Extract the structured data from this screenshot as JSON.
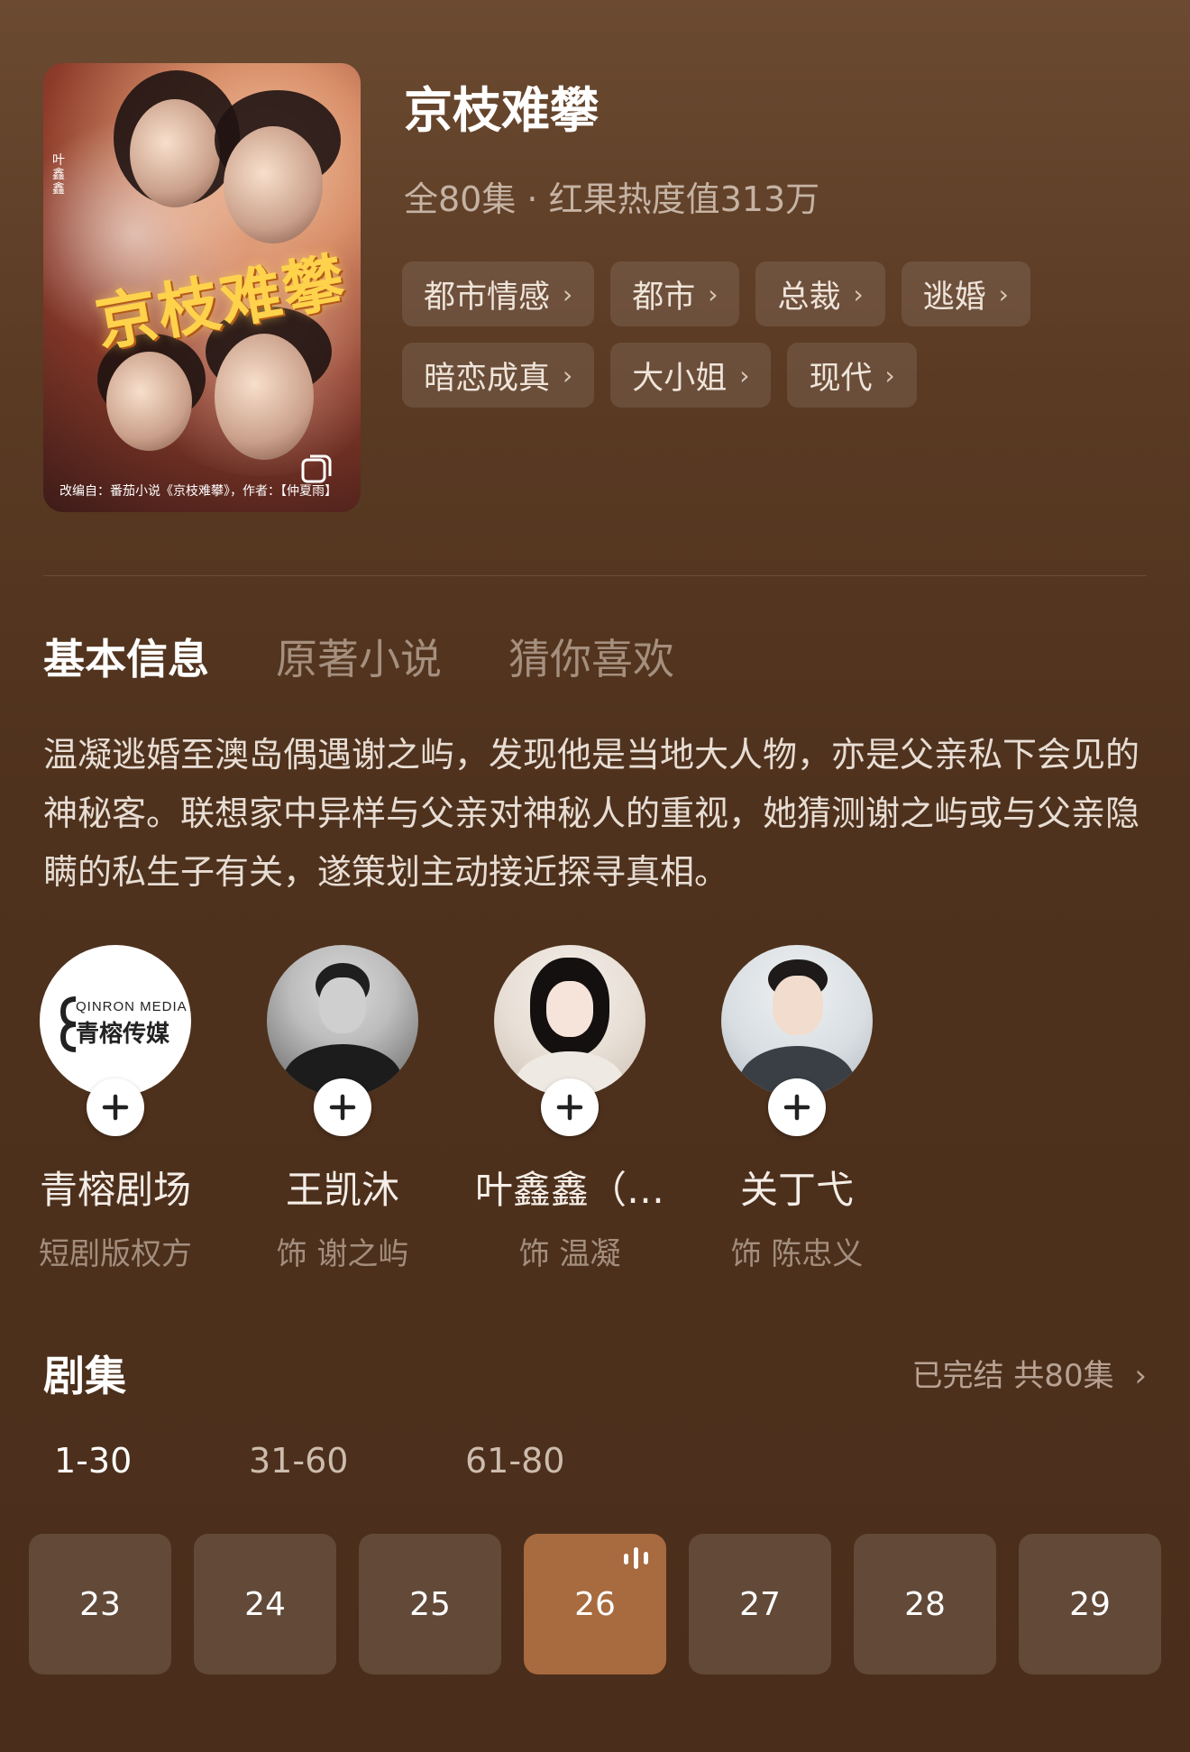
{
  "drama": {
    "title": "京枝难攀",
    "meta": "全80集 · 红果热度值313万",
    "tags": [
      "都市情感",
      "都市",
      "总裁",
      "逃婚",
      "暗恋成真",
      "大小姐",
      "现代"
    ]
  },
  "poster": {
    "title_art": "京枝难攀",
    "side_text": "叶鑫鑫",
    "caption": "改编自：番茄小说《京枝难攀》，作者：【仲夏雨】"
  },
  "tabs": [
    "基本信息",
    "原著小说",
    "猜你喜欢"
  ],
  "description": "温凝逃婚至澳岛偶遇谢之屿，发现他是当地大人物，亦是父亲私下会见的神秘客。联想家中异样与父亲对神秘人的重视，她猜测谢之屿或与父亲隐瞒的私生子有关，遂策划主动接近探寻真相。",
  "people": [
    {
      "name": "青榕剧场",
      "role": "短剧版权方",
      "logo_en": "QINRON MEDIA",
      "logo_cn": "青榕传媒"
    },
    {
      "name": "王凯沐",
      "role": "饰 谢之屿"
    },
    {
      "name": "叶鑫鑫（…",
      "role": "饰 温凝"
    },
    {
      "name": "关丁弋",
      "role": "饰 陈忠义"
    }
  ],
  "episodes": {
    "heading": "剧集",
    "status": "已完结 共80集",
    "ranges": [
      "1-30",
      "31-60",
      "61-80"
    ],
    "active_range": "1-30",
    "numbers": [
      "23",
      "24",
      "25",
      "26",
      "27",
      "28",
      "29"
    ],
    "playing": "26"
  },
  "colors": {
    "background": "#4f321d",
    "playing_episode": "#a86a3f"
  }
}
